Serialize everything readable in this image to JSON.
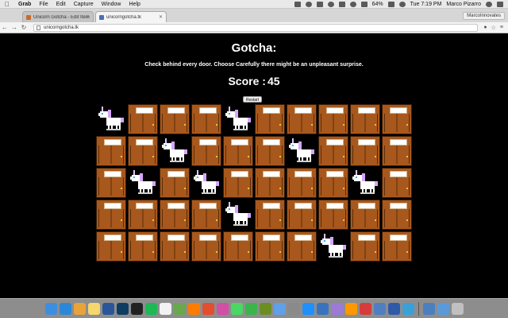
{
  "menubar": {
    "app": "Grab",
    "items": [
      "File",
      "Edit",
      "Capture",
      "Window",
      "Help"
    ],
    "battery": "64%",
    "clock": "Tue 7:19 PM",
    "user": "Marco Pizarro"
  },
  "browser": {
    "tabs": [
      {
        "label": "Unicorn Gotcha - Edit Item",
        "active": false
      },
      {
        "label": "unicorngotcha.tk",
        "active": true
      }
    ],
    "profile": "MarcoInnovates",
    "url": "unicorngotcha.tk"
  },
  "game": {
    "title": "Gotcha:",
    "subtitle": "Check behind every door. Choose Carefully there might be an unpleasant surprise.",
    "score_label": "Score :",
    "score": "45",
    "restart_label": "Restart",
    "grid": [
      [
        "unicorn",
        "door",
        "door",
        "door",
        "unicorn",
        "door",
        "door",
        "door",
        "door",
        "door"
      ],
      [
        "door",
        "door",
        "unicorn",
        "door",
        "door",
        "door",
        "unicorn",
        "door",
        "door",
        "door"
      ],
      [
        "door",
        "unicorn",
        "door",
        "unicorn",
        "door",
        "door",
        "door",
        "door",
        "unicorn",
        "door"
      ],
      [
        "door",
        "door",
        "door",
        "door",
        "unicorn",
        "door",
        "door",
        "door",
        "door",
        "door"
      ],
      [
        "door",
        "door",
        "door",
        "door",
        "door",
        "door",
        "door",
        "unicorn",
        "door",
        "door"
      ]
    ]
  },
  "dock": {
    "icons": [
      {
        "name": "finder-icon",
        "color": "#3d8ee0"
      },
      {
        "name": "safari-icon",
        "color": "#2b88d8"
      },
      {
        "name": "photos-icon",
        "color": "#e8a33a"
      },
      {
        "name": "notes-icon",
        "color": "#f5d76e"
      },
      {
        "name": "word-icon",
        "color": "#2a5699"
      },
      {
        "name": "photoshop-icon",
        "color": "#0f3c63"
      },
      {
        "name": "terminal-icon",
        "color": "#222222"
      },
      {
        "name": "spotify-icon",
        "color": "#1db954"
      },
      {
        "name": "calendar-icon",
        "color": "#f2f2f2"
      },
      {
        "name": "preview-icon",
        "color": "#6aa84f"
      },
      {
        "name": "illustrator-icon",
        "color": "#ff7c00"
      },
      {
        "name": "chrome-icon",
        "color": "#e44d2e"
      },
      {
        "name": "itunes-icon",
        "color": "#d14fa5"
      },
      {
        "name": "messages-icon",
        "color": "#4bd763"
      },
      {
        "name": "facetime-icon",
        "color": "#3bb54a"
      },
      {
        "name": "minecraft-icon",
        "color": "#6b8e23"
      },
      {
        "name": "mail-icon",
        "color": "#5fa0e8"
      },
      {
        "name": "settings-icon",
        "color": "#8a8a8a"
      },
      {
        "name": "appstore-icon",
        "color": "#1e90ff"
      },
      {
        "name": "xcode-icon",
        "color": "#3973bd"
      },
      {
        "name": "cube-icon",
        "color": "#9b7ad8"
      },
      {
        "name": "sublime-icon",
        "color": "#ff9800"
      },
      {
        "name": "app-icon",
        "color": "#d83b3b"
      },
      {
        "name": "keynote-icon",
        "color": "#4f7fc0"
      },
      {
        "name": "flag-icon",
        "color": "#2f5aa8"
      },
      {
        "name": "globe-icon",
        "color": "#3aa0d8"
      }
    ],
    "right_icons": [
      {
        "name": "downloads-icon",
        "color": "#4a7fc0"
      },
      {
        "name": "folder-icon",
        "color": "#5a9ad8"
      },
      {
        "name": "trash-icon",
        "color": "#c0c0c0"
      }
    ]
  }
}
